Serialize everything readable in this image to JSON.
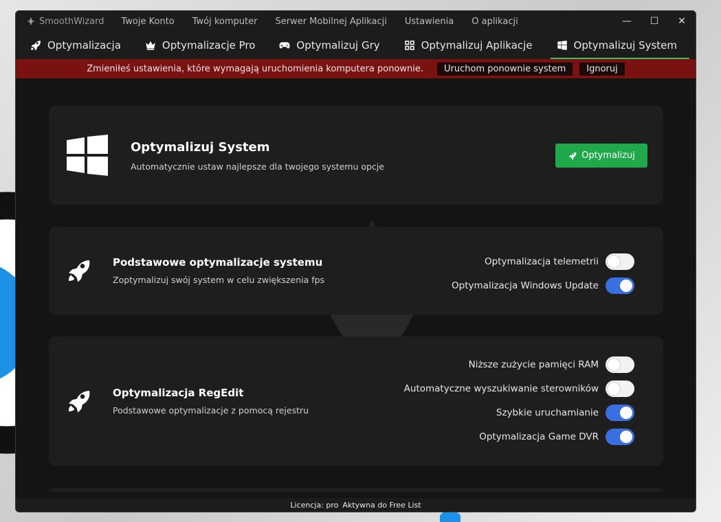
{
  "app": {
    "name": "SmoothWizard",
    "menu": [
      "Twoje Konto",
      "Twój komputer",
      "Serwer Mobilnej Aplikacji",
      "Ustawienia",
      "O aplikacji"
    ]
  },
  "tabs": [
    {
      "label": "Optymalizacja",
      "icon": "rocket-icon"
    },
    {
      "label": "Optymalizacje Pro",
      "icon": "crown-icon"
    },
    {
      "label": "Optymalizuj Gry",
      "icon": "gamepad-icon"
    },
    {
      "label": "Optymalizuj Aplikacje",
      "icon": "apps-grid-icon"
    },
    {
      "label": "Optymalizuj System",
      "icon": "windows-icon",
      "active": true
    }
  ],
  "alert": {
    "message": "Zmieniłeś ustawienia, które wymagają uruchomienia komputera ponownie.",
    "restart_label": "Uruchom ponownie system",
    "ignore_label": "Ignoruj"
  },
  "hero": {
    "title": "Optymalizuj System",
    "subtitle": "Automatycznie ustaw najlepsze dla twojego systemu opcje",
    "button_label": "Optymalizuj"
  },
  "sections": [
    {
      "title": "Podstawowe optymalizacje systemu",
      "subtitle": "Zoptymalizuj swój system w celu zwiększenia fps",
      "toggles": [
        {
          "label": "Optymalizacja telemetrii",
          "on": false
        },
        {
          "label": "Optymalizacja Windows Update",
          "on": true
        }
      ]
    },
    {
      "title": "Optymalizacja RegEdit",
      "subtitle": "Podstawowe optymalizacje z pomocą rejestru",
      "toggles": [
        {
          "label": "Niższe zużycie pamięci RAM",
          "on": false
        },
        {
          "label": "Automatyczne wyszukiwanie sterowników",
          "on": false
        },
        {
          "label": "Szybkie uruchamianie",
          "on": true
        },
        {
          "label": "Optymalizacja Game DVR",
          "on": true
        }
      ]
    }
  ],
  "status": {
    "license_label": "Licencja: pro",
    "license_status": "Aktywna do Free List"
  },
  "colors": {
    "accent_green": "#1fa94a",
    "toggle_on": "#3a6fe0",
    "alert_red": "#7a1212"
  }
}
